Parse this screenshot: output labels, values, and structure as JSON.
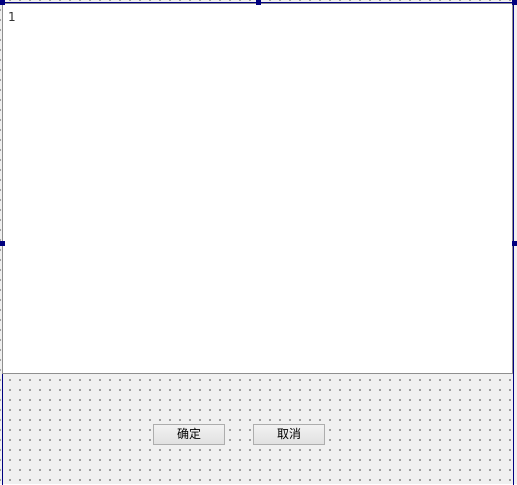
{
  "editor": {
    "text": "1"
  },
  "buttons": {
    "ok_label": "确定",
    "cancel_label": "取消"
  },
  "colors": {
    "selection_handle": "#00007f",
    "grid_dot": "#8a8a8a",
    "form_background": "#f0f0f0"
  }
}
